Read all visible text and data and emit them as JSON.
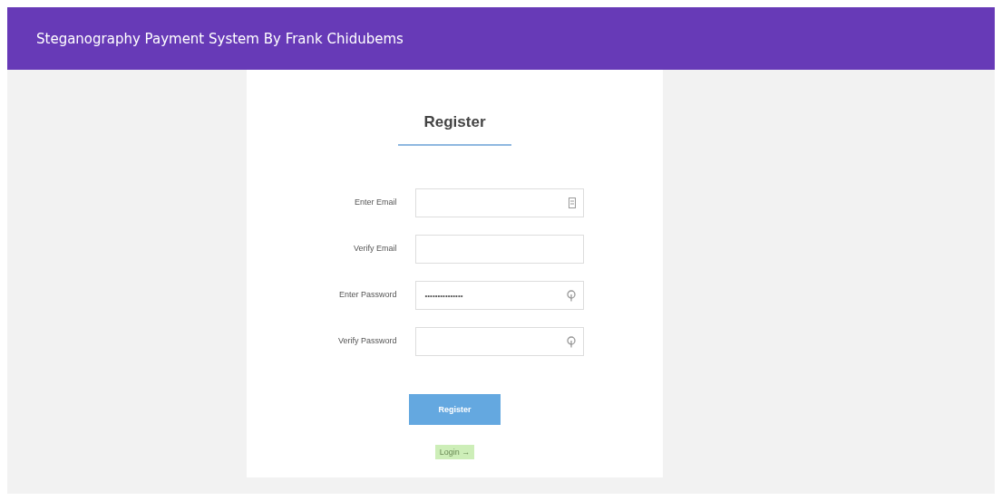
{
  "header": {
    "title": "Steganography Payment System By Frank Chidubems"
  },
  "form": {
    "title": "Register",
    "fields": [
      {
        "label": "Enter Email",
        "kind": "email"
      },
      {
        "label": "Verify Email",
        "kind": "plain"
      },
      {
        "label": "Enter Password",
        "value": "•••••••••••••••",
        "kind": "password"
      },
      {
        "label": "Verify Password",
        "kind": "password"
      }
    ],
    "submit": "Register",
    "login_link": "Login →"
  }
}
